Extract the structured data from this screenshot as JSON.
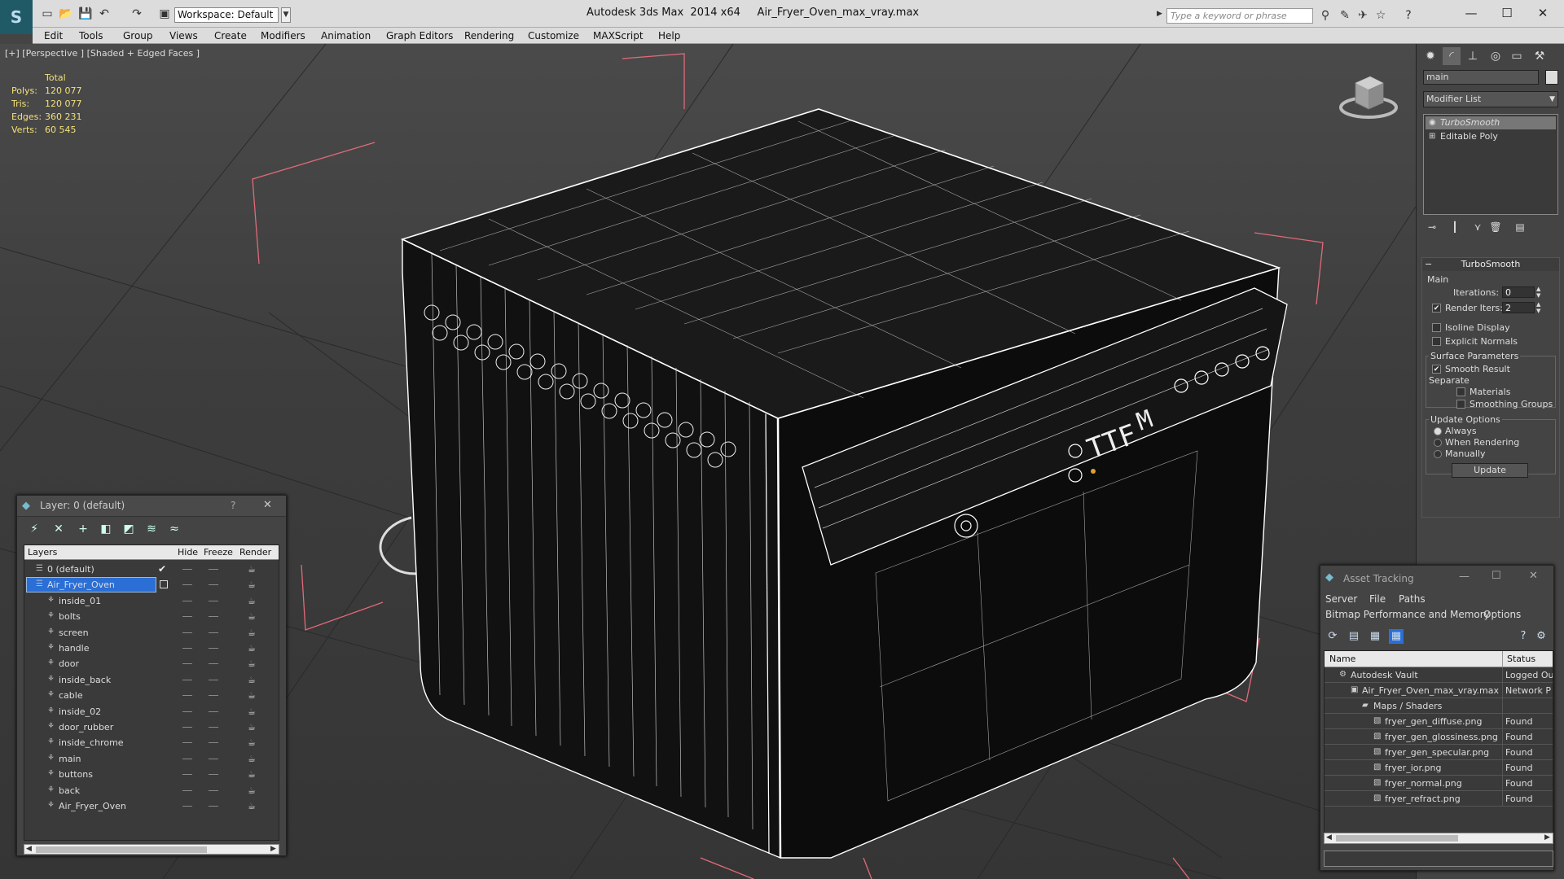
{
  "app": {
    "logo_glyph": "S",
    "title": "Autodesk 3ds Max  2014 x64     Air_Fryer_Oven_max_vray.max",
    "workspace": "Workspace: Default",
    "search_placeholder": "Type a keyword or phrase"
  },
  "menu": [
    "Edit",
    "Tools",
    "Group",
    "Views",
    "Create",
    "Modifiers",
    "Animation",
    "Graph Editors",
    "Rendering",
    "Customize",
    "MAXScript",
    "Help"
  ],
  "viewport": {
    "label": "[+] [Perspective ] [Shaded + Edged Faces ]",
    "stats_header": "Total",
    "stats": [
      {
        "label": "Polys:",
        "value": "120 077"
      },
      {
        "label": "Tris:",
        "value": "120 077"
      },
      {
        "label": "Edges:",
        "value": "360 231"
      },
      {
        "label": "Verts:",
        "value": "60 545"
      }
    ],
    "display_text_1": "TTF",
    "display_text_2": "M"
  },
  "layer_dialog": {
    "title": "Layer: 0 (default)",
    "help": "?",
    "close": "✕",
    "columns": {
      "layers": "Layers",
      "hide": "Hide",
      "freeze": "Freeze",
      "render": "Render"
    },
    "rows": [
      {
        "name": "0 (default)",
        "level": 0,
        "active": true,
        "selected": false
      },
      {
        "name": "Air_Fryer_Oven",
        "level": 0,
        "active": false,
        "selected": true
      },
      {
        "name": "inside_01",
        "level": 1
      },
      {
        "name": "bolts",
        "level": 1
      },
      {
        "name": "screen",
        "level": 1
      },
      {
        "name": "handle",
        "level": 1
      },
      {
        "name": "door",
        "level": 1
      },
      {
        "name": "inside_back",
        "level": 1
      },
      {
        "name": "cable",
        "level": 1
      },
      {
        "name": "inside_02",
        "level": 1
      },
      {
        "name": "door_rubber",
        "level": 1
      },
      {
        "name": "inside_chrome",
        "level": 1
      },
      {
        "name": "main",
        "level": 1
      },
      {
        "name": "buttons",
        "level": 1
      },
      {
        "name": "back",
        "level": 1
      },
      {
        "name": "Air_Fryer_Oven",
        "level": 1
      }
    ]
  },
  "command_panel": {
    "object_name": "main",
    "modifier_list": "Modifier List",
    "stack": [
      "TurboSmooth",
      "Editable Poly"
    ],
    "turbosmooth": {
      "header": "TurboSmooth",
      "main": "Main",
      "iterations_label": "Iterations:",
      "iterations": "0",
      "render_iters_label": "Render Iters:",
      "render_iters": "2",
      "isoline": "Isoline Display",
      "explicit": "Explicit Normals",
      "surface": "Surface Parameters",
      "smooth_result": "Smooth Result",
      "separate": "Separate",
      "materials": "Materials",
      "smoothing_groups": "Smoothing Groups",
      "update_options": "Update Options",
      "always": "Always",
      "when_rendering": "When Rendering",
      "manually": "Manually",
      "update": "Update"
    }
  },
  "asset_tracking": {
    "title": "Asset Tracking",
    "menus": [
      "Server",
      "File",
      "Paths"
    ],
    "menus2": [
      "Bitmap Performance and Memory",
      "Options"
    ],
    "columns": {
      "name": "Name",
      "status": "Status"
    },
    "rows": [
      {
        "name": "Autodesk Vault",
        "status": "Logged Ou",
        "indent": 1,
        "icon": "vault-icon"
      },
      {
        "name": "Air_Fryer_Oven_max_vray.max",
        "status": "Network P",
        "indent": 2,
        "icon": "max-file-icon"
      },
      {
        "name": "Maps / Shaders",
        "status": "",
        "indent": 3,
        "icon": "maps-icon"
      },
      {
        "name": "fryer_gen_diffuse.png",
        "status": "Found",
        "indent": 4,
        "icon": "image-icon"
      },
      {
        "name": "fryer_gen_glossiness.png",
        "status": "Found",
        "indent": 4,
        "icon": "image-icon"
      },
      {
        "name": "fryer_gen_specular.png",
        "status": "Found",
        "indent": 4,
        "icon": "image-icon"
      },
      {
        "name": "fryer_ior.png",
        "status": "Found",
        "indent": 4,
        "icon": "image-icon"
      },
      {
        "name": "fryer_normal.png",
        "status": "Found",
        "indent": 4,
        "icon": "image-icon"
      },
      {
        "name": "fryer_refract.png",
        "status": "Found",
        "indent": 4,
        "icon": "image-icon"
      }
    ]
  },
  "colors": {
    "accent": "#2b6fd6",
    "stats": "#f2e07a",
    "bbox": "#e06a7a",
    "wire": "#ffffff"
  }
}
